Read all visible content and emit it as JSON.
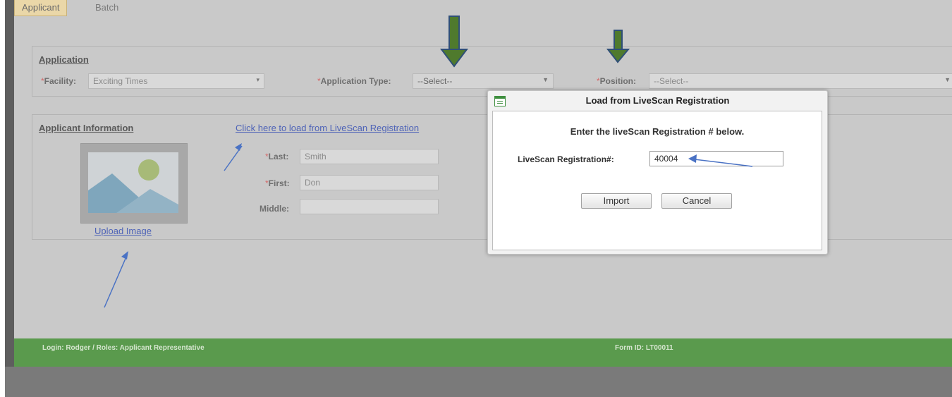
{
  "tabs": [
    {
      "label": "Applicant",
      "active": true
    },
    {
      "label": "Batch",
      "active": false
    }
  ],
  "application": {
    "title": "Application",
    "facility_label": "Facility:",
    "facility_value": "Exciting Times",
    "app_type_label": "Application Type:",
    "app_type_value": "--Select--",
    "position_label": "Position:",
    "position_value": "--Select--"
  },
  "applicant": {
    "title": "Applicant Information",
    "load_link": "Click here to load from LiveScan Registration",
    "last_label": "Last:",
    "last_value": "Smith",
    "first_label": "First:",
    "first_value": "Don",
    "middle_label": "Middle:",
    "middle_value": "",
    "upload_link": "Upload Image"
  },
  "required_mark": "*",
  "dialog": {
    "title": "Load from LiveScan Registration",
    "instruction": "Enter the liveScan Registration # below.",
    "reg_label": "LiveScan Registration#:",
    "reg_value": "40004",
    "import_label": "Import",
    "cancel_label": "Cancel"
  },
  "footer": {
    "login_text": "Login: Rodger  /  Roles: Applicant Representative",
    "form_id": "Form ID: LT00011"
  },
  "colors": {
    "footer_green": "#5a9a4d",
    "link_blue": "#4e63b7",
    "annotation_arrow_green": "#4f7a2d",
    "annotation_arrow_blue": "#4a72c4",
    "required_red": "#d46a6a"
  }
}
